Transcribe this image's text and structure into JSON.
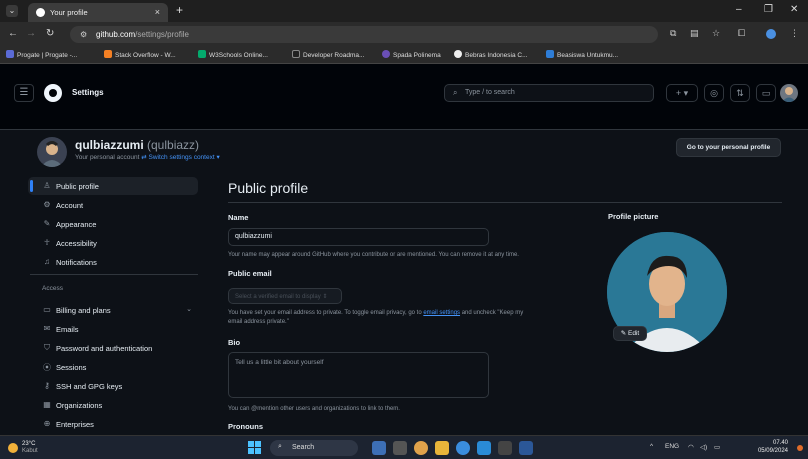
{
  "browser": {
    "tab_title": "Your profile",
    "url_host": "github.com",
    "url_path": "/settings/profile",
    "bookmarks": [
      "Progate | Progate -...",
      "Stack Overflow - W...",
      "W3Schools Online...",
      "Developer Roadma...",
      "Spada Polinema",
      "Bebras Indonesia C...",
      "Beasiswa Untukmu..."
    ]
  },
  "header": {
    "section": "Settings",
    "search_placeholder": "Type / to search"
  },
  "account": {
    "username": "qulbiazzumi",
    "handle": "(qulbiazz)",
    "subtitle": "Your personal account",
    "switch_label": "Switch settings context",
    "go_profile_label": "Go to your personal profile"
  },
  "sidebar": {
    "items": [
      {
        "label": "Public profile",
        "icon": "person-icon"
      },
      {
        "label": "Account",
        "icon": "gear-icon"
      },
      {
        "label": "Appearance",
        "icon": "paintbrush-icon"
      },
      {
        "label": "Accessibility",
        "icon": "accessibility-icon"
      },
      {
        "label": "Notifications",
        "icon": "bell-icon"
      }
    ],
    "group_label": "Access",
    "access_items": [
      {
        "label": "Billing and plans",
        "icon": "credit-card-icon"
      },
      {
        "label": "Emails",
        "icon": "mail-icon"
      },
      {
        "label": "Password and authentication",
        "icon": "shield-lock-icon"
      },
      {
        "label": "Sessions",
        "icon": "broadcast-icon"
      },
      {
        "label": "SSH and GPG keys",
        "icon": "key-icon"
      },
      {
        "label": "Organizations",
        "icon": "organization-icon"
      },
      {
        "label": "Enterprises",
        "icon": "globe-icon"
      }
    ]
  },
  "main": {
    "title": "Public profile",
    "name_label": "Name",
    "name_value": "qulbiazzumi",
    "name_note": "Your name may appear around GitHub where you contribute or are mentioned. You can remove it at any time.",
    "email_label": "Public email",
    "email_select": "Select a verified email to display",
    "email_note_1": "You have set your email address to private. To toggle email privacy, go to",
    "email_note_link": "email settings",
    "email_note_2": "and uncheck \"Keep my",
    "email_note_3": "email address private.\"",
    "bio_label": "Bio",
    "bio_placeholder": "Tell us a little bit about yourself",
    "bio_note": "You can @mention other users and organizations to link to them.",
    "pronouns_label": "Pronouns",
    "picture_label": "Profile picture",
    "edit_label": "Edit"
  },
  "taskbar": {
    "temp": "23°C",
    "weather": "Kabut",
    "search": "Search",
    "lang": "ENG",
    "time": "07.40",
    "date": "05/09/2024"
  }
}
